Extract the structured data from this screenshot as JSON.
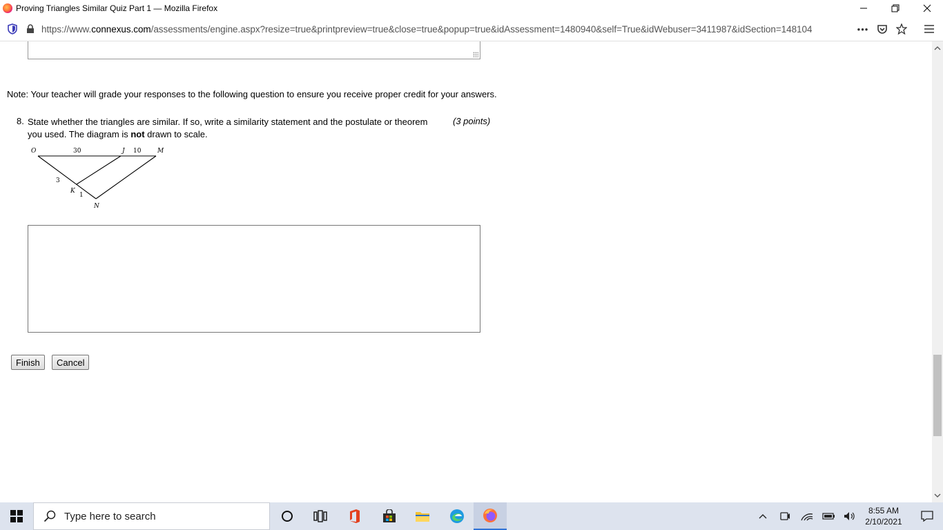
{
  "window": {
    "title": "Proving Triangles Similar Quiz Part 1 — Mozilla Firefox",
    "minimize": "—",
    "restore": "❐",
    "close": "✕"
  },
  "navbar": {
    "url_prefix": "https://www.",
    "url_host": "connexus.com",
    "url_rest": "/assessments/engine.aspx?resize=true&printpreview=true&close=true&popup=true&idAssessment=1480940&self=True&idWebuser=3411987&idSection=148104",
    "more": "•••"
  },
  "page": {
    "note": "Note: Your teacher will grade your responses to the following question to ensure you receive proper credit for your answers.",
    "question": {
      "number": "8.",
      "text_before_bold": "State whether the triangles are similar. If so, write a similarity statement and the postulate or theorem you used. The diagram is ",
      "bold": "not",
      "text_after_bold": " drawn to scale.",
      "points": "(3 points)",
      "diagram": {
        "labels": {
          "O": "O",
          "J": "J",
          "M": "M",
          "K": "K",
          "N": "N"
        },
        "lengths": {
          "OJ": "30",
          "JM": "10",
          "OK": "3",
          "KN": "1"
        }
      }
    },
    "answer_value": "",
    "buttons": {
      "finish": "Finish",
      "cancel": "Cancel"
    }
  },
  "taskbar": {
    "search_placeholder": "Type here to search",
    "time": "8:55 AM",
    "date": "2/10/2021"
  },
  "colors": {
    "taskbar_bg": "#dde3ee",
    "active_underline": "#3072d5"
  }
}
